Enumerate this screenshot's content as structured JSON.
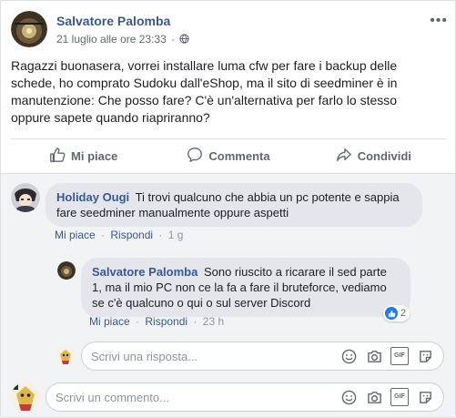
{
  "post": {
    "author": "Salvatore Palomba",
    "date": "21 luglio alle ore 23:33",
    "text": "Ragazzi buonasera, vorrei installare luma cfw per fare i backup delle schede, ho comprato Sudoku dall'eShop, ma il sito di seedminer è in manutenzione: Che posso fare? C'è un'alternativa per farlo lo stesso oppure sapete quando riapriranno?"
  },
  "actions": {
    "like": "Mi piace",
    "comment": "Commenta",
    "share": "Condividi"
  },
  "comments": [
    {
      "author": "Holiday Ougi",
      "text": "Ti trovi qualcuno che abbia un pc potente e sappia fare seedminer manualmente oppure aspetti",
      "like_label": "Mi piace",
      "reply_label": "Rispondi",
      "ago": "1 g"
    },
    {
      "author": "Salvatore Palomba",
      "text": "Sono riuscito a ricarare il sed parte 1, ma il mio PC non ce la fa a fare il bruteforce, vediamo se c'è qualcuno o qui o sul server Discord",
      "like_label": "Mi piace",
      "reply_label": "Rispondi",
      "ago": "23 h",
      "reaction_count": "2"
    }
  ],
  "reply_input": {
    "placeholder": "Scrivi una risposta..."
  },
  "comment_input": {
    "placeholder": "Scrivi un commento..."
  },
  "icons": {
    "more": "more-horizontal-icon",
    "like": "thumbs-up-icon",
    "comment": "speech-bubble-icon",
    "share": "share-arrow-icon",
    "emoji": "emoji-icon",
    "camera": "camera-icon",
    "gif": "GIF",
    "sticker": "sticker-icon"
  },
  "colors": {
    "link": "#385898",
    "like_blue": "#2078f4",
    "muted": "#606770"
  }
}
